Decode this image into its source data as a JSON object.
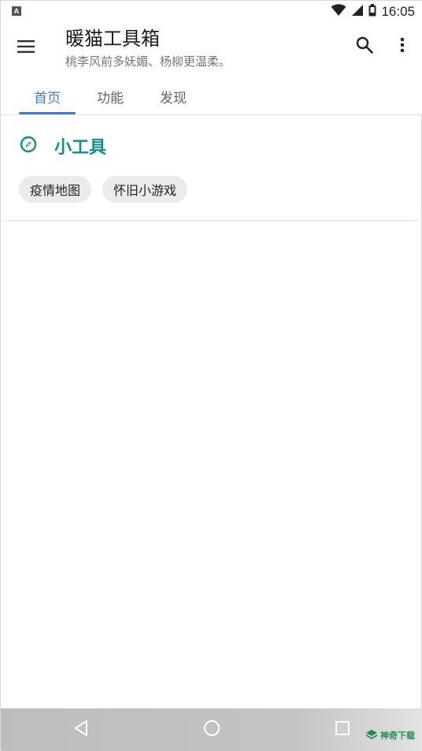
{
  "status_bar": {
    "time": "16:05",
    "app_icon_letter": "A",
    "icons": [
      "wifi-icon",
      "signal-icon",
      "battery-icon"
    ]
  },
  "app_bar": {
    "title": "暖猫工具箱",
    "subtitle": "桃李风前多妩媚、杨柳更温柔。",
    "icons": [
      "menu-icon",
      "search-icon",
      "more-vert-icon"
    ]
  },
  "tabs": [
    {
      "label": "首页",
      "active": true
    },
    {
      "label": "功能",
      "active": false
    },
    {
      "label": "发现",
      "active": false
    }
  ],
  "card": {
    "icon": "compass-icon",
    "title": "小工具",
    "chips": [
      {
        "label": "疫情地图"
      },
      {
        "label": "怀旧小游戏"
      }
    ]
  },
  "nav_bar": {
    "icons": [
      "back-icon",
      "home-icon",
      "recents-icon"
    ],
    "watermark_text": "神奇下载"
  },
  "colors": {
    "accent_blue": "#3a7bd5",
    "accent_teal": "#0f8f86",
    "chip_bg": "#ebebeb",
    "nav_bg": "#bdbdbd"
  }
}
